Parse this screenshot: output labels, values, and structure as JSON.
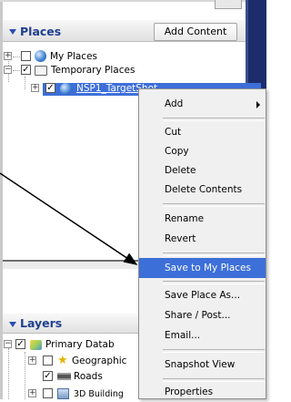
{
  "places": {
    "title": "Places",
    "add_content_label": "Add Content",
    "items": [
      {
        "label": "My Places",
        "checked": false,
        "expanded": false
      },
      {
        "label": "Temporary Places",
        "checked": true,
        "expanded": true
      },
      {
        "label": "NSP1_TargetShot",
        "checked": true,
        "expanded": false,
        "selected": true
      }
    ]
  },
  "layers": {
    "title": "Layers",
    "items": [
      {
        "label": "Primary Datab",
        "checked": true,
        "expanded": true
      },
      {
        "label": "Geographic",
        "checked": false,
        "expanded": false
      },
      {
        "label": "Roads",
        "checked": true
      },
      {
        "label": "3D Building",
        "checked": false,
        "expanded": false
      }
    ]
  },
  "context_menu": {
    "items": [
      {
        "label": "Add",
        "has_submenu": true
      },
      {
        "label": "Cut"
      },
      {
        "label": "Copy"
      },
      {
        "label": "Delete"
      },
      {
        "label": "Delete Contents"
      },
      {
        "label": "Rename"
      },
      {
        "label": "Revert"
      },
      {
        "label": "Save to My Places",
        "highlighted": true
      },
      {
        "label": "Save Place As..."
      },
      {
        "label": "Share / Post..."
      },
      {
        "label": "Email..."
      },
      {
        "label": "Snapshot View"
      },
      {
        "label": "Properties"
      }
    ]
  },
  "colors": {
    "header_text": "#1f3f8f",
    "selection": "#3d6fd9",
    "right_strip": "#1d2d6b"
  }
}
